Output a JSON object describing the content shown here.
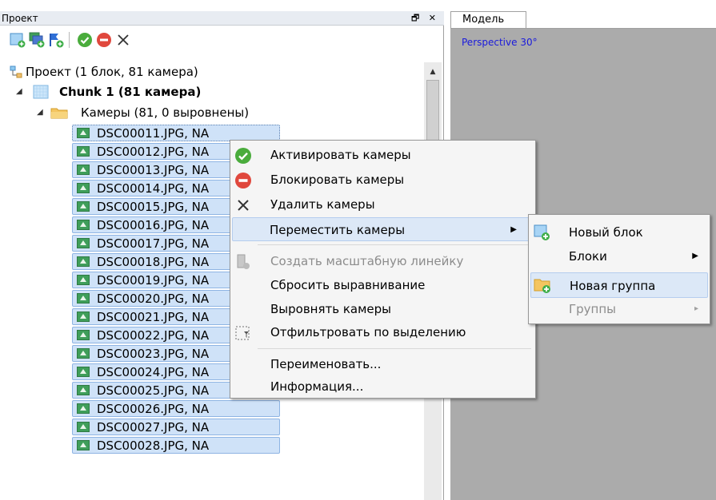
{
  "panel": {
    "title": "Проект",
    "float_btn": "🗗",
    "close_btn": "✕"
  },
  "tree": {
    "project_label": "Проект (1 блок, 81 камера)",
    "chunk_label": "Chunk 1 (81 камера)",
    "cameras_folder_label": "Камеры (81, 0 выровнены)",
    "cameras": [
      "DSC00011.JPG, NA",
      "DSC00012.JPG, NA",
      "DSC00013.JPG, NA",
      "DSC00014.JPG, NA",
      "DSC00015.JPG, NA",
      "DSC00016.JPG, NA",
      "DSC00017.JPG, NA",
      "DSC00018.JPG, NA",
      "DSC00019.JPG, NA",
      "DSC00020.JPG, NA",
      "DSC00021.JPG, NA",
      "DSC00022.JPG, NA",
      "DSC00023.JPG, NA",
      "DSC00024.JPG, NA",
      "DSC00025.JPG, NA",
      "DSC00026.JPG, NA",
      "DSC00027.JPG, NA",
      "DSC00028.JPG, NA"
    ]
  },
  "model": {
    "tab_label": "Модель",
    "perspective_label": "Perspective 30°"
  },
  "context_menu": {
    "enable_cameras": "Активировать камеры",
    "disable_cameras": "Блокировать камеры",
    "remove_cameras": "Удалить камеры",
    "move_cameras": "Переместить камеры",
    "create_scale_bar": "Создать масштабную линейку",
    "reset_alignment": "Сбросить выравнивание",
    "align_cameras": "Выровнять камеры",
    "filter_by_selection": "Отфильтровать по выделению",
    "rename": "Переименовать...",
    "info": "Информация..."
  },
  "submenu": {
    "new_chunk": "Новый блок",
    "chunks": "Блоки",
    "new_group": "Новая группа",
    "groups": "Группы"
  },
  "colors": {
    "selection": "#cfe2f8",
    "menu_highlight": "#dce8f7",
    "model_bg": "#ababab",
    "perspective_text": "#1a1adc"
  }
}
